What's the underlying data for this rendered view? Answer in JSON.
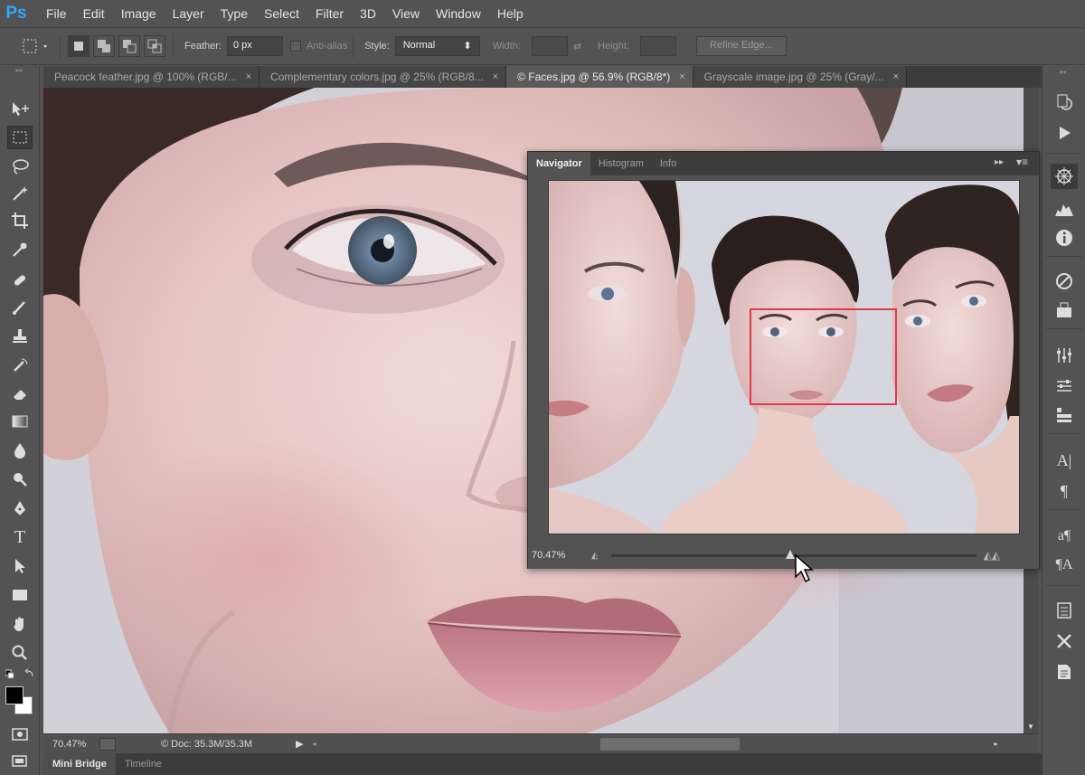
{
  "app": {
    "logo": "Ps"
  },
  "menu": [
    "File",
    "Edit",
    "Image",
    "Layer",
    "Type",
    "Select",
    "Filter",
    "3D",
    "View",
    "Window",
    "Help"
  ],
  "options": {
    "feather_label": "Feather:",
    "feather_value": "0 px",
    "antialias_label": "Anti-alias",
    "style_label": "Style:",
    "style_value": "Normal",
    "width_label": "Width:",
    "height_label": "Height:",
    "refine_edge_label": "Refine Edge..."
  },
  "tabs": [
    {
      "label": "Peacock feather.jpg @ 100% (RGB/...",
      "active": false
    },
    {
      "label": "Complementary colors.jpg @ 25% (RGB/8...",
      "active": false
    },
    {
      "label": "© Faces.jpg @ 56.9% (RGB/8*)",
      "active": true
    },
    {
      "label": "Grayscale image.jpg @ 25% (Gray/...",
      "active": false
    }
  ],
  "tab_close_glyph": "×",
  "status": {
    "zoom": "70.47%",
    "doc_info": "Doc: 35.3M/35.3M"
  },
  "bottom_tabs": [
    "Mini Bridge",
    "Timeline"
  ],
  "navigator": {
    "tabs": [
      "Navigator",
      "Histogram",
      "Info"
    ],
    "zoom_value": "70.47%",
    "zoom_slider_fraction": 0.49
  },
  "colors": {
    "accent_logo": "#31a8ff",
    "proxy_box": "#e0394b",
    "panel_bg": "#535353"
  },
  "icons": {
    "left_tools": [
      "move-tool-icon",
      "marquee-tool-icon",
      "lasso-tool-icon",
      "magic-wand-icon",
      "crop-tool-icon",
      "eyedropper-icon",
      "healing-brush-icon",
      "brush-tool-icon",
      "clone-stamp-icon",
      "history-brush-icon",
      "eraser-icon",
      "gradient-tool-icon",
      "blur-tool-icon",
      "dodge-tool-icon",
      "pen-tool-icon",
      "type-tool-icon",
      "path-select-icon",
      "shape-tool-icon",
      "hand-tool-icon",
      "zoom-tool-icon"
    ],
    "right_dock": [
      "history-icon",
      "actions-icon",
      "navigator-icon",
      "histogram-icon",
      "info-icon",
      "color-icon",
      "swatches-icon",
      "adjustments-icon",
      "properties-icon",
      "layers-icon",
      "character-icon",
      "paragraph-icon",
      "char-styles-icon",
      "para-styles-icon",
      "layer-comps-icon",
      "tools-presets-icon",
      "notes-icon"
    ]
  }
}
